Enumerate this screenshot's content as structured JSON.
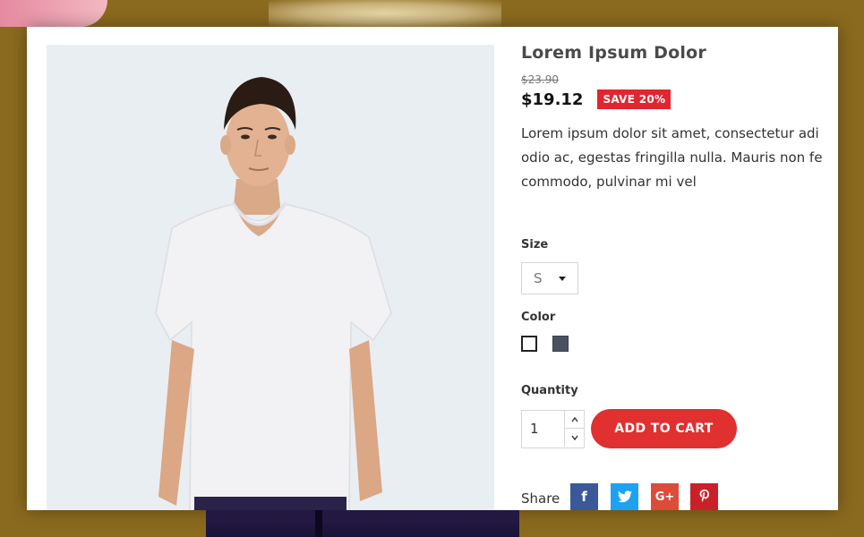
{
  "product": {
    "title": "Lorem Ipsum Dolor",
    "old_price": "$23.90",
    "price": "$19.12",
    "save_badge": "SAVE 20%",
    "description": [
      "Lorem ipsum dolor sit amet, consectetur adi",
      "odio ac, egestas fringilla nulla. Mauris non fe",
      "commodo, pulvinar mi vel"
    ]
  },
  "size": {
    "label": "Size",
    "selected": "S"
  },
  "color": {
    "label": "Color",
    "options": [
      "#ffffff",
      "#4a5260"
    ]
  },
  "quantity": {
    "label": "Quantity",
    "value": "1"
  },
  "cart": {
    "add_label": "ADD TO CART"
  },
  "share": {
    "label": "Share",
    "networks": [
      {
        "name": "facebook",
        "glyph": "f"
      },
      {
        "name": "twitter",
        "glyph": "t"
      },
      {
        "name": "google-plus",
        "glyph": "G+"
      },
      {
        "name": "pinterest",
        "glyph": "P"
      }
    ]
  },
  "colors": {
    "accent": "#e0302f",
    "badge": "#e0262f",
    "facebook": "#3b5998",
    "twitter": "#1da1f2",
    "google_plus": "#dd4b39",
    "pinterest": "#cb2027"
  }
}
